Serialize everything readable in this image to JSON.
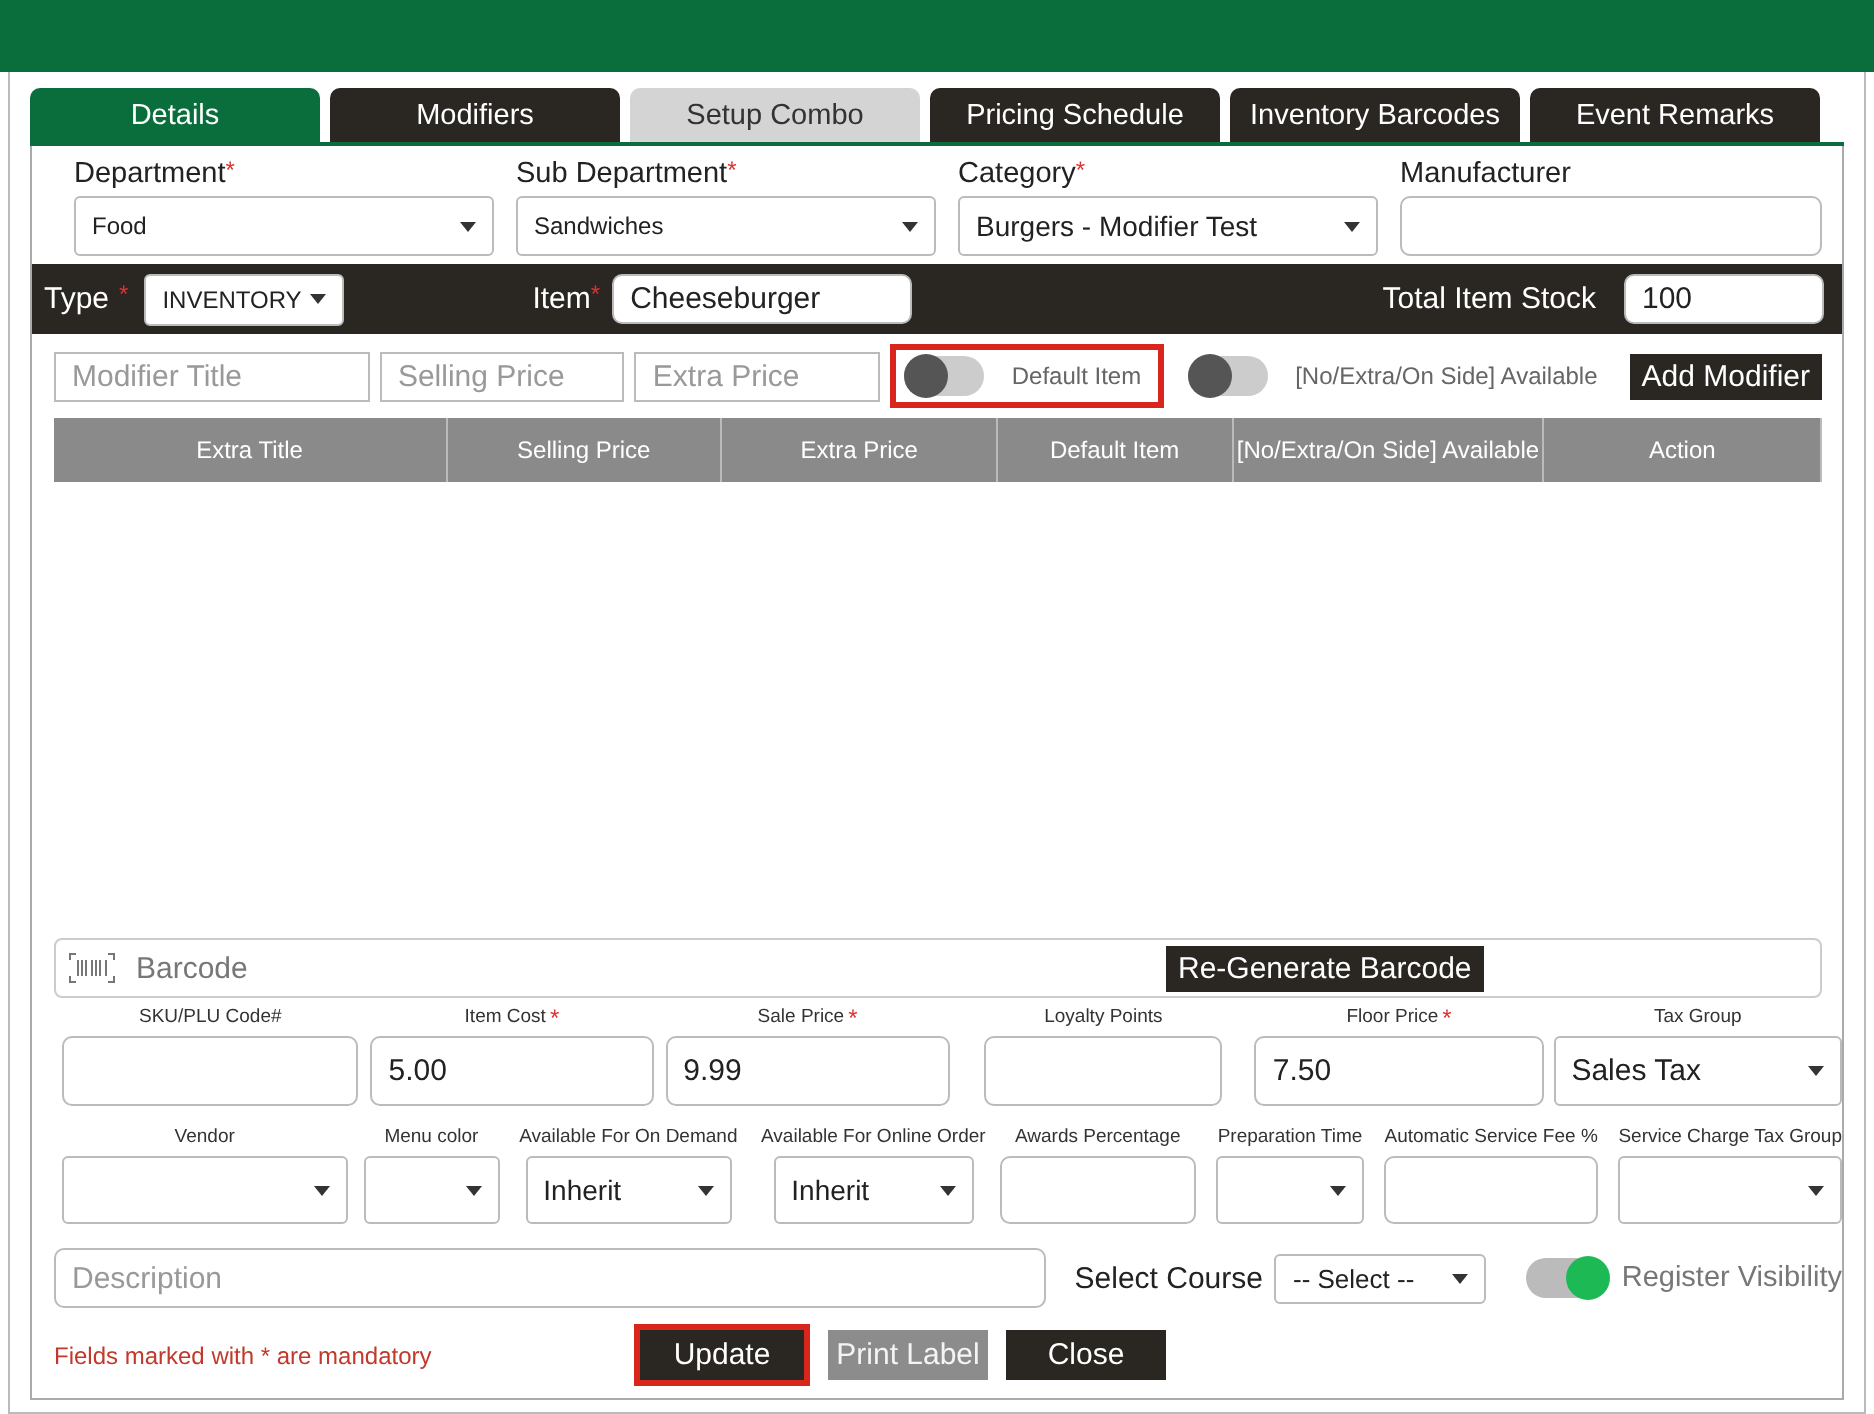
{
  "tabs": [
    {
      "label": "Details",
      "selected": true,
      "disabled": false
    },
    {
      "label": "Modifiers",
      "selected": false,
      "disabled": false
    },
    {
      "label": "Setup Combo",
      "selected": false,
      "disabled": true
    },
    {
      "label": "Pricing Schedule",
      "selected": false,
      "disabled": false
    },
    {
      "label": "Inventory Barcodes",
      "selected": false,
      "disabled": false
    },
    {
      "label": "Event Remarks",
      "selected": false,
      "disabled": false
    }
  ],
  "top_fields": [
    {
      "label": "Department",
      "mark": "*",
      "kind": "select",
      "value": "Food"
    },
    {
      "label": "Sub Department",
      "mark": "*",
      "kind": "select",
      "value": "Sandwiches"
    },
    {
      "label": "Category",
      "mark": "*",
      "kind": "select",
      "value": "Burgers - Modifier Test"
    },
    {
      "label": "Manufacturer",
      "kind": "input"
    }
  ],
  "item_bar": {
    "type_label": "Type",
    "type_mark": "*",
    "type_value": "INVENTORY",
    "item_label": "Item",
    "item_mark": "*",
    "item_value": "Cheeseburger",
    "stock_label": "Total Item Stock",
    "stock_value": "100"
  },
  "modifier_form": {
    "inputs": [
      {
        "placeholder": "Modifier Title"
      },
      {
        "placeholder": "Selling Price"
      },
      {
        "placeholder": "Extra Price"
      }
    ],
    "toggles": [
      {
        "label": "Default Item",
        "on": false,
        "highlighted": true
      },
      {
        "label": "[No/Extra/On Side] Available",
        "on": false,
        "highlighted": false
      }
    ],
    "button": "Add Modifier"
  },
  "table": {
    "columns": [
      "Extra Title",
      "Selling Price",
      "Extra Price",
      "Default Item",
      "[No/Extra/On Side] Available",
      "Action"
    ]
  },
  "barcode": {
    "placeholder": "Barcode",
    "button": "Re-Generate Barcode"
  },
  "price_fields": [
    {
      "label": "SKU/PLU Code#",
      "kind": "input"
    },
    {
      "label": "Item Cost",
      "mark": "*",
      "kind": "input",
      "value": "5.00"
    },
    {
      "label": "Sale Price",
      "mark": "*",
      "kind": "input",
      "value": "9.99"
    },
    {
      "label": "Loyalty Points",
      "kind": "input"
    },
    {
      "label": "Floor Price",
      "mark": "*",
      "kind": "input",
      "value": "7.50"
    },
    {
      "label": "Tax Group",
      "kind": "select",
      "value": "Sales Tax"
    }
  ],
  "option_fields": [
    {
      "label": "Vendor",
      "kind": "select"
    },
    {
      "label": "Menu color",
      "kind": "select"
    },
    {
      "label": "Available For On Demand",
      "kind": "select",
      "value": "Inherit"
    },
    {
      "label": "Available For Online Order",
      "kind": "select",
      "value": "Inherit"
    },
    {
      "label": "Awards Percentage",
      "kind": "input"
    },
    {
      "label": "Preparation Time",
      "kind": "select"
    },
    {
      "label": "Automatic Service Fee %",
      "kind": "input"
    },
    {
      "label": "Service Charge Tax Group",
      "kind": "select"
    }
  ],
  "description": {
    "placeholder": "Description"
  },
  "course": {
    "label": "Select Course",
    "value": "-- Select --"
  },
  "register_visibility": {
    "label": "Register Visibility",
    "on": true
  },
  "note": "Fields marked with * are mandatory",
  "buttons": [
    {
      "label": "Update",
      "disabled": false,
      "highlighted": true
    },
    {
      "label": "Print Label",
      "disabled": true,
      "highlighted": false
    },
    {
      "label": "Close",
      "disabled": false,
      "highlighted": false
    }
  ]
}
